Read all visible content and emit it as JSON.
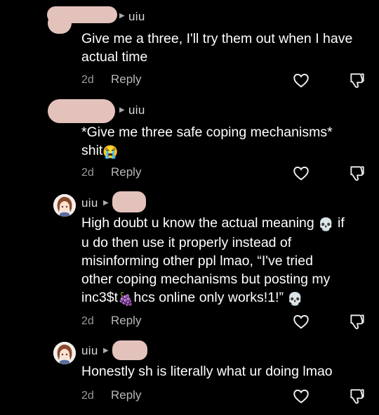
{
  "comments": [
    {
      "username": "uiu",
      "text_lines": [
        "Give me a three, I'll try them out when I have",
        "actual time"
      ],
      "age": "2d",
      "reply_label": "Reply"
    },
    {
      "username": "uiu",
      "text_lines": [
        "*Give me three safe coping mechanisms*",
        "shit"
      ],
      "emoji": "😭",
      "age": "2d",
      "reply_label": "Reply"
    },
    {
      "username": "uiu",
      "text_lines": [
        "High doubt u know the actual meaning",
        "if",
        "u do then use it properly instead of",
        "misinforming other ppl lmao, “I've tried",
        "other coping mechanisms but posting my",
        "inc3$t",
        "hcs online only works!1!”"
      ],
      "emoji_skull": "💀",
      "emoji_grapes": "🍇",
      "age": "2d",
      "reply_label": "Reply"
    },
    {
      "username": "uiu",
      "text_lines": [
        "Honestly sh is literally what ur doing lmao"
      ],
      "age": "2d",
      "reply_label": "Reply"
    }
  ],
  "icons": {
    "like": "heart-icon",
    "dislike": "thumbs-down-icon",
    "reply_arrow": "reply-arrow-icon"
  }
}
